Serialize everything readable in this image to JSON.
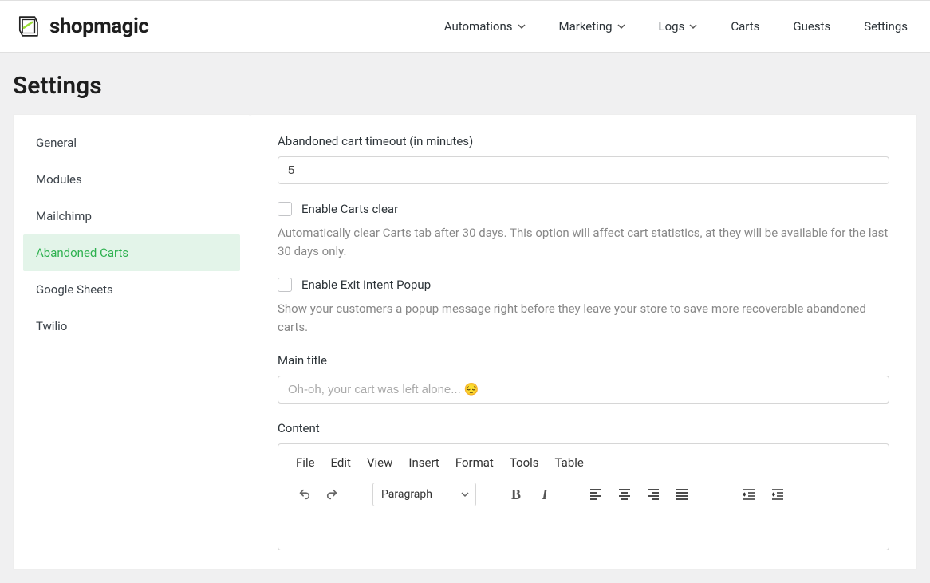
{
  "header": {
    "brand": "shopmagic",
    "nav": [
      {
        "label": "Automations",
        "dropdown": true
      },
      {
        "label": "Marketing",
        "dropdown": true
      },
      {
        "label": "Logs",
        "dropdown": true
      },
      {
        "label": "Carts",
        "dropdown": false
      },
      {
        "label": "Guests",
        "dropdown": false
      },
      {
        "label": "Settings",
        "dropdown": false
      }
    ]
  },
  "page": {
    "title": "Settings"
  },
  "sidebar": {
    "items": [
      "General",
      "Modules",
      "Mailchimp",
      "Abandoned Carts",
      "Google Sheets",
      "Twilio"
    ],
    "activeIndex": 3
  },
  "form": {
    "timeout_label": "Abandoned cart timeout (in minutes)",
    "timeout_value": "5",
    "enable_clear_label": "Enable Carts clear",
    "enable_clear_help": "Automatically clear Carts tab after 30 days. This option will affect cart statistics, at they will be available for the last 30 days only.",
    "enable_exit_label": "Enable Exit Intent Popup",
    "enable_exit_help": "Show your customers a popup message right before they leave your store to save more recoverable abandoned carts.",
    "main_title_label": "Main title",
    "main_title_placeholder": "Oh-oh, your cart was left alone... 😔",
    "content_label": "Content"
  },
  "editor": {
    "menu": [
      "File",
      "Edit",
      "View",
      "Insert",
      "Format",
      "Tools",
      "Table"
    ],
    "format_select": "Paragraph"
  }
}
